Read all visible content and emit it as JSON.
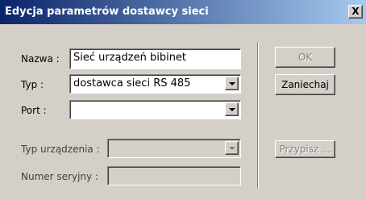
{
  "dialog": {
    "title": "Edycja parametrów dostawcy sieci",
    "close_glyph": "X"
  },
  "form": {
    "name_label": "Nazwa :",
    "name_value": "Sieć urządzeń bibinet",
    "type_label": "Typ :",
    "type_value": "dostawca sieci RS 485",
    "port_label": "Port :",
    "port_value": "",
    "device_type_label": "Typ urządzenia :",
    "device_type_value": "",
    "serial_label": "Numer seryjny :",
    "serial_value": ""
  },
  "buttons": {
    "ok": "OK",
    "cancel": "Zaniechaj",
    "assign": "Przypisz ..."
  },
  "colors": {
    "title_start": "#0a246a",
    "title_end": "#a6caf0",
    "face": "#d4d0c8"
  }
}
